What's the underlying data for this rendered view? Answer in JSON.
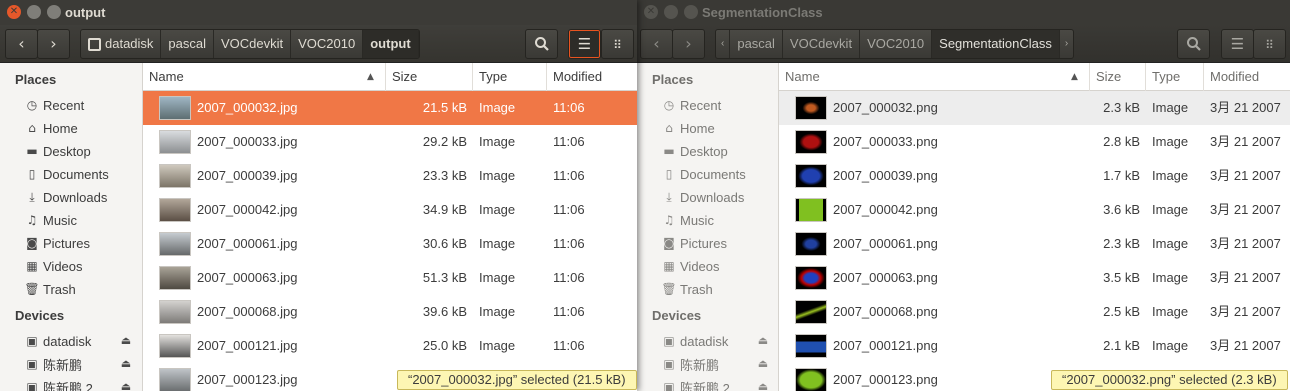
{
  "left": {
    "title": "output",
    "crumbs": [
      "datadisk",
      "pascal",
      "VOCdevkit",
      "VOC2010",
      "output"
    ],
    "columns": [
      "Name",
      "Size",
      "Type",
      "Modified"
    ],
    "places_title": "Places",
    "devices_title": "Devices",
    "places": [
      "Recent",
      "Home",
      "Desktop",
      "Documents",
      "Downloads",
      "Music",
      "Pictures",
      "Videos",
      "Trash"
    ],
    "devices": [
      "datadisk",
      "陈新鹏",
      "陈新鹏 2"
    ],
    "rows": [
      {
        "name": "2007_000032.jpg",
        "size": "21.5 kB",
        "type": "Image",
        "modified": "11:06"
      },
      {
        "name": "2007_000033.jpg",
        "size": "29.2 kB",
        "type": "Image",
        "modified": "11:06"
      },
      {
        "name": "2007_000039.jpg",
        "size": "23.3 kB",
        "type": "Image",
        "modified": "11:06"
      },
      {
        "name": "2007_000042.jpg",
        "size": "34.9 kB",
        "type": "Image",
        "modified": "11:06"
      },
      {
        "name": "2007_000061.jpg",
        "size": "30.6 kB",
        "type": "Image",
        "modified": "11:06"
      },
      {
        "name": "2007_000063.jpg",
        "size": "51.3 kB",
        "type": "Image",
        "modified": "11:06"
      },
      {
        "name": "2007_000068.jpg",
        "size": "39.6 kB",
        "type": "Image",
        "modified": "11:06"
      },
      {
        "name": "2007_000121.jpg",
        "size": "25.0 kB",
        "type": "Image",
        "modified": "11:06"
      },
      {
        "name": "2007_000123.jpg",
        "size": "",
        "type": "",
        "modified": ""
      }
    ],
    "status": "“2007_000032.jpg” selected  (21.5 kB)"
  },
  "right": {
    "title": "SegmentationClass",
    "crumbs": [
      "pascal",
      "VOCdevkit",
      "VOC2010",
      "SegmentationClass"
    ],
    "columns": [
      "Name",
      "Size",
      "Type",
      "Modified"
    ],
    "places_title": "Places",
    "devices_title": "Devices",
    "places": [
      "Recent",
      "Home",
      "Desktop",
      "Documents",
      "Downloads",
      "Music",
      "Pictures",
      "Videos",
      "Trash"
    ],
    "devices": [
      "datadisk",
      "陈新鹏",
      "陈新鹏 2"
    ],
    "rows": [
      {
        "name": "2007_000032.png",
        "size": "2.3 kB",
        "type": "Image",
        "modified": "3月 21 2007"
      },
      {
        "name": "2007_000033.png",
        "size": "2.8 kB",
        "type": "Image",
        "modified": "3月 21 2007"
      },
      {
        "name": "2007_000039.png",
        "size": "1.7 kB",
        "type": "Image",
        "modified": "3月 21 2007"
      },
      {
        "name": "2007_000042.png",
        "size": "3.6 kB",
        "type": "Image",
        "modified": "3月 21 2007"
      },
      {
        "name": "2007_000061.png",
        "size": "2.3 kB",
        "type": "Image",
        "modified": "3月 21 2007"
      },
      {
        "name": "2007_000063.png",
        "size": "3.5 kB",
        "type": "Image",
        "modified": "3月 21 2007"
      },
      {
        "name": "2007_000068.png",
        "size": "2.5 kB",
        "type": "Image",
        "modified": "3月 21 2007"
      },
      {
        "name": "2007_000121.png",
        "size": "2.1 kB",
        "type": "Image",
        "modified": "3月 21 2007"
      },
      {
        "name": "2007_000123.png",
        "size": "",
        "type": "",
        "modified": ""
      }
    ],
    "status": "“2007_000032.png” selected  (2.3 kB)"
  },
  "colors": {
    "accent": "#f07746",
    "titlebar": "#3c3b37",
    "status_bg": "#fdf6b3"
  },
  "icons": {
    "places": [
      "clock-icon",
      "home-icon",
      "folder-icon",
      "document-icon",
      "download-icon",
      "music-icon",
      "camera-icon",
      "film-icon",
      "trash-icon"
    ],
    "devices": [
      "drive-icon",
      "drive-icon",
      "drive-icon"
    ]
  }
}
